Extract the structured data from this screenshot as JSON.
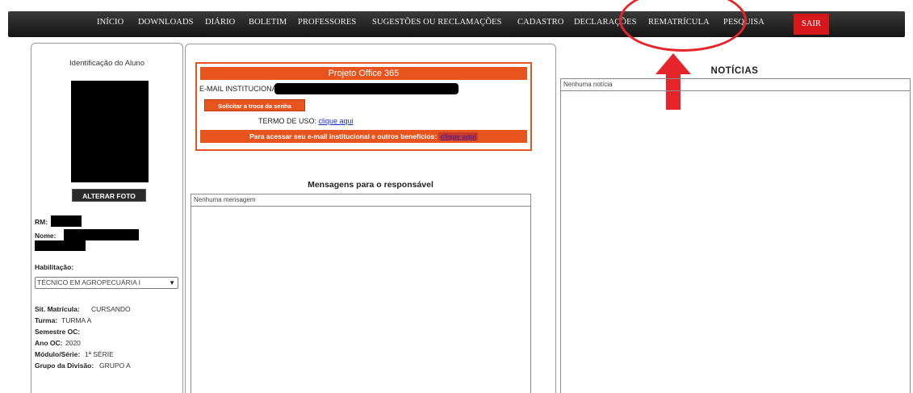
{
  "nav": {
    "items": [
      "INÍCIO",
      "DOWNLOADS",
      "DIÁRIO",
      "BOLETIM",
      "PROFESSORES",
      "SUGESTÕES OU RECLAMAÇÕES",
      "CADASTRO",
      "DECLARAÇÕES",
      "REMATRÍCULA",
      "PESQUISA"
    ],
    "logout": "SAIR"
  },
  "student": {
    "section_title": "Identificação do Aluno",
    "change_photo_button": "ALTERAR FOTO",
    "rm_label": "RM:",
    "name_label": "Nome:",
    "program_label": "Habilitação:",
    "program_selected": "TÉCNICO EM AGROPECUÁRIA I",
    "enrollment_status_label": "Sit. Matrícula:",
    "enrollment_status": "CURSANDO",
    "class_label": "Turma:",
    "class_value": "TURMA A",
    "semester_label": "Semestre OC:",
    "semester_value": "",
    "year_label": "Ano OC:",
    "year_value": "2020",
    "module_label": "Módulo/Série:",
    "module_value": "1ª SÉRIE",
    "division_label": "Grupo da Divisão:",
    "division_value": "GRUPO A"
  },
  "office": {
    "title": "Projeto Office 365",
    "email_label": "E-MAIL INSTITUCIONAL:",
    "change_password_button": "Solicitar a troca da senha",
    "terms_label": "TERMO DE USO:",
    "terms_link": "clique aqui",
    "access_text": "Para acessar seu e-mail institucional e outros benefícios:",
    "access_link": "clique aqui"
  },
  "messages": {
    "title": "Mensagens para o responsável",
    "empty_text": "Nenhuma mensagem"
  },
  "news": {
    "title": "NOTÍCIAS",
    "empty_text": "Nenhuma notícia"
  },
  "colors": {
    "accent_orange": "#e8541e",
    "logout_red": "#d5171b",
    "annotation_red": "#e5252a",
    "nav_background": "#1e1e1e"
  }
}
